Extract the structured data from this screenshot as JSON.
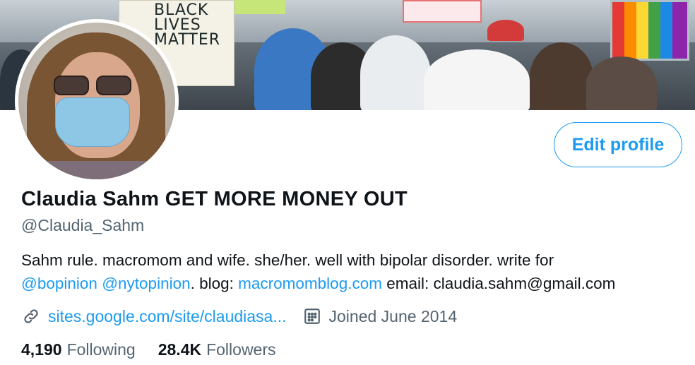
{
  "banner": {
    "sign_text": "BLACK\nLIVES\nMATTER"
  },
  "profile": {
    "edit_button_label": "Edit profile",
    "display_name": "Claudia Sahm GET MORE MONEY OUT",
    "handle": "@Claudia_Sahm",
    "bio_line1": "Sahm rule. macromom and wife. she/her. well with bipolar disorder. write for",
    "bio_mention1": "@bopinion",
    "bio_mention2": "@nytopinion",
    "bio_blog_label": ". blog: ",
    "bio_blog_link": "macromomblog.com",
    "bio_email": " email: claudia.sahm@gmail.com",
    "website": "sites.google.com/site/claudiasa...",
    "joined": "Joined June 2014"
  },
  "stats": {
    "following_count": "4,190",
    "following_label": "Following",
    "followers_count": "28.4K",
    "followers_label": "Followers"
  },
  "colors": {
    "accent": "#1d9bf0",
    "secondary_text": "#536471",
    "primary_text": "#0f1419"
  },
  "icons": {
    "website": "link-icon",
    "joined": "calendar-icon"
  }
}
